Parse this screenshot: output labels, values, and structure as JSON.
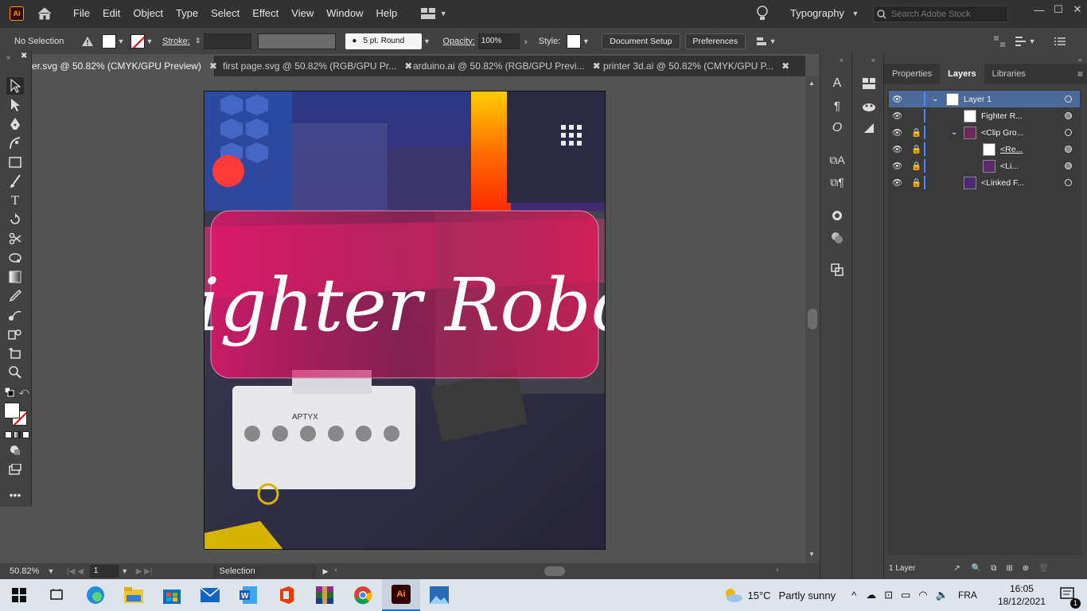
{
  "app": {
    "logo": "Ai",
    "accent": "#ff9a00"
  },
  "menu": [
    "File",
    "Edit",
    "Object",
    "Type",
    "Select",
    "Effect",
    "View",
    "Window",
    "Help"
  ],
  "workspace": "Typography",
  "search": {
    "placeholder": "Search Adobe Stock"
  },
  "control": {
    "selection": "No Selection",
    "stroke_label": "Stroke:",
    "brush": "5 pt. Round",
    "opacity_label": "Opacity:",
    "opacity": "100%",
    "style_label": "Style:",
    "doc_setup": "Document Setup",
    "preferences": "Preferences"
  },
  "tabs": [
    {
      "label": "er.svg @ 50.82% (CMYK/GPU Preview)",
      "close": "✖",
      "active": true
    },
    {
      "label": "first page.svg @ 50.82% (RGB/GPU Pr...",
      "close": "✖"
    },
    {
      "label": "arduino.ai @ 50.82% (RGB/GPU Previ...",
      "close": "✖"
    },
    {
      "label": "printer 3d.ai @ 50.82% (CMYK/GPU P...",
      "close": "✖"
    }
  ],
  "artboard": {
    "headline": "Fighter Robot",
    "robot_label": "APTYX"
  },
  "status": {
    "zoom": "50.82%",
    "page": "1",
    "tool": "Selection"
  },
  "panel": {
    "tabs": [
      "Properties",
      "Layers",
      "Libraries"
    ],
    "active_tab": "Layers",
    "layers": [
      {
        "name": "Layer 1"
      },
      {
        "name": "Fighter R..."
      },
      {
        "name": "<Clip Gro..."
      },
      {
        "name": "<Re..."
      },
      {
        "name": "<Li..."
      },
      {
        "name": "<Linked F..."
      }
    ],
    "footer": "1 Layer"
  },
  "taskbar": {
    "weather_temp": "15°C",
    "weather_desc": "Partly sunny",
    "lang": "FRA",
    "time": "16:05",
    "date": "18/12/2021",
    "notifications": "1"
  }
}
